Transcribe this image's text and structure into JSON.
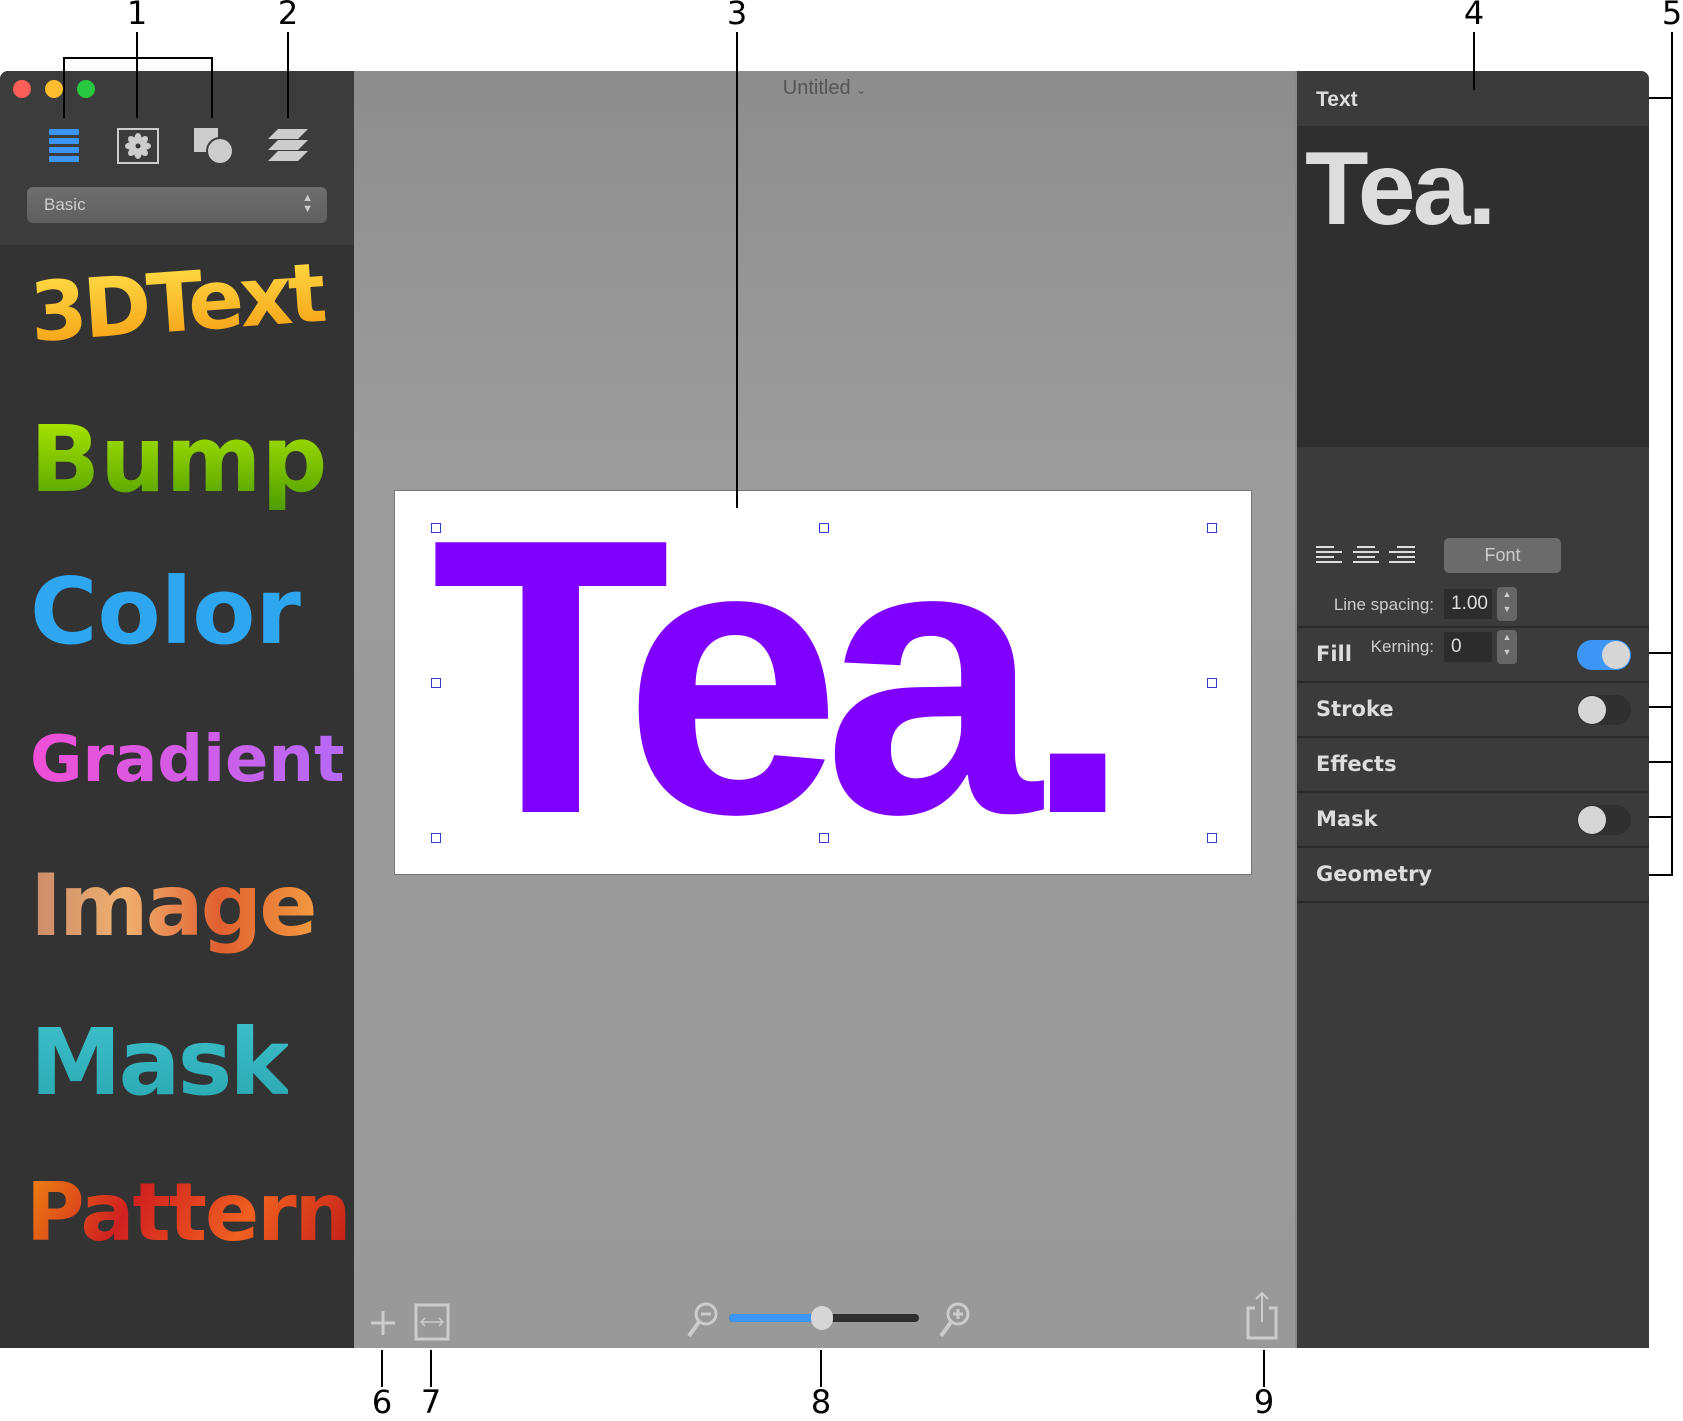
{
  "window": {
    "title": "Untitled",
    "controls": [
      "close",
      "minimize",
      "zoom"
    ]
  },
  "sidebar": {
    "tools": [
      {
        "icon": "list-icon",
        "active": true
      },
      {
        "icon": "gear-image-icon"
      },
      {
        "icon": "shapes-icon"
      },
      {
        "icon": "layers-icon"
      }
    ],
    "category": "Basic",
    "samples": [
      "3DText",
      "Bump",
      "Color",
      "Gradient",
      "Image",
      "Mask",
      "Pattern"
    ]
  },
  "canvas": {
    "text": "Tea.",
    "text_color": "#8000ff"
  },
  "inspector": {
    "header": "Text",
    "preview": "Tea.",
    "font_button": "Font",
    "line_spacing_label": "Line spacing:",
    "line_spacing": "1.00",
    "kerning_label": "Kerning:",
    "kerning": "0",
    "sections": [
      {
        "label": "Fill",
        "toggle": true
      },
      {
        "label": "Stroke",
        "toggle": false
      },
      {
        "label": "Effects"
      },
      {
        "label": "Mask",
        "toggle": false
      },
      {
        "label": "Geometry"
      }
    ]
  },
  "bottom_bar": {
    "zoom_level": 0.49
  },
  "callouts": [
    "1",
    "2",
    "3",
    "4",
    "5",
    "6",
    "7",
    "8",
    "9"
  ],
  "colors": {
    "accent": "#3d95f5",
    "sidebar": "#333333",
    "canvas": "#9a9a9a"
  }
}
